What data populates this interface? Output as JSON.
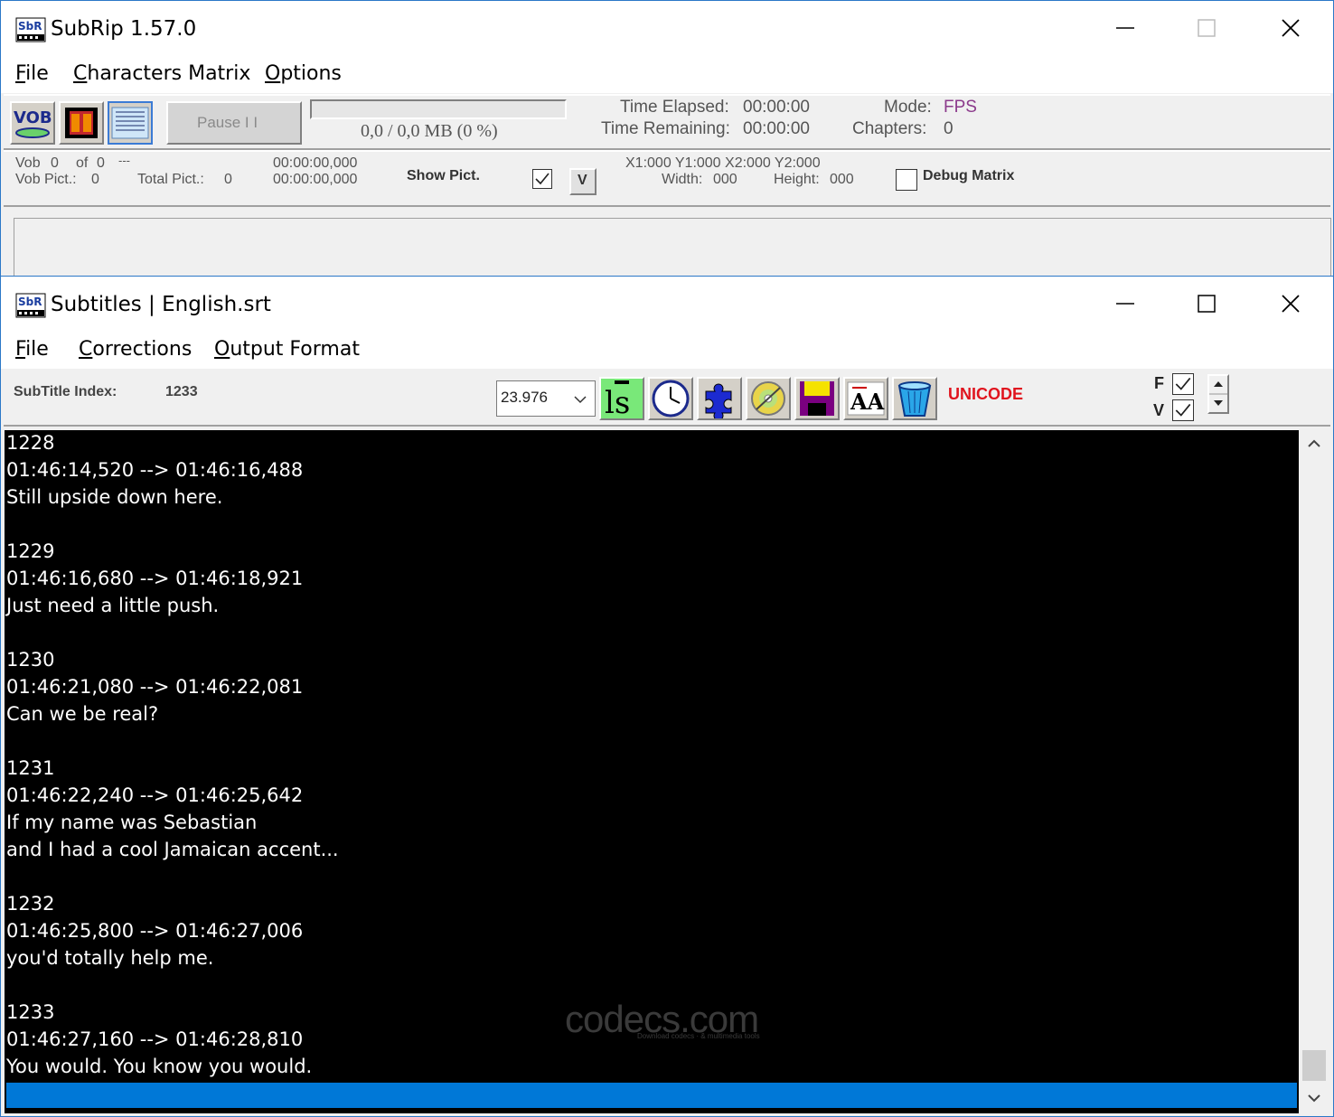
{
  "main_window": {
    "title": "SubRip 1.57.0",
    "menu": [
      {
        "mn": "F",
        "rest": "ile"
      },
      {
        "mn": "C",
        "rest": "haracters Matrix"
      },
      {
        "mn": "O",
        "rest": "ptions"
      }
    ],
    "toolbar": {
      "pause_label": "Pause  I I",
      "progress_text": "0,0 / 0,0 MB (0 %)",
      "progress_fraction": 0,
      "time_elapsed_label": "Time Elapsed:",
      "time_elapsed": "00:00:00",
      "time_remaining_label": "Time Remaining:",
      "time_remaining": "00:00:00",
      "mode_label": "Mode:",
      "mode_value": "FPS",
      "chapters_label": "Chapters:",
      "chapters_value": "0"
    },
    "info": {
      "vob_label": "Vob",
      "vob_value": "0",
      "of_label": "of",
      "of_value": "0",
      "dashes": "---",
      "vob_pict_label": "Vob Pict.:",
      "vob_pict_value": "0",
      "total_pict_label": "Total Pict.:",
      "total_pict_value": "0",
      "time1": "00:00:00,000",
      "time2": "00:00:00,000",
      "show_pict": "Show Pict.",
      "v_button": "V",
      "coords": "X1:000  Y1:000  X2:000  Y2:000",
      "width_label": "Width:",
      "width_value": "000",
      "height_label": "Height:",
      "height_value": "000",
      "debug_matrix": "Debug Matrix"
    }
  },
  "subtitles_window": {
    "title": "Subtitles | English.srt",
    "menu": [
      {
        "mn": "F",
        "rest": "ile"
      },
      {
        "mn": "C",
        "rest": "orrections"
      },
      {
        "mn": "O",
        "rest": "utput Format"
      }
    ],
    "toolbar": {
      "index_label": "SubTitle Index:",
      "index_value": "1233",
      "fps_value": "23.976",
      "unicode_label": "UNICODE",
      "f_label": "F",
      "v_label": "V"
    },
    "lines": [
      "1228",
      "01:46:14,520 --> 01:46:16,488",
      "Still upside down here.",
      "",
      "1229",
      "01:46:16,680 --> 01:46:18,921",
      "Just need a little push.",
      "",
      "1230",
      "01:46:21,080 --> 01:46:22,081",
      "Can we be real?",
      "",
      "1231",
      "01:46:22,240 --> 01:46:25,642",
      "If my name was Sebastian",
      "and I had a cool Jamaican accent...",
      "",
      "1232",
      "01:46:25,800 --> 01:46:27,006",
      "you'd totally help me.",
      "",
      "1233",
      "01:46:27,160 --> 01:46:28,810",
      "You would. You know you would."
    ],
    "watermark": "codecs.com",
    "watermark_sub": "Download codecs · & multimedia tools"
  },
  "colors": {
    "accent": "#0078d7",
    "mode_value": "#8b3a8b",
    "unicode": "#e0141e"
  },
  "icons": [
    "app-icon",
    "minimize-icon",
    "maximize-icon",
    "close-icon",
    "vob-icon",
    "film-icon",
    "matrix-icon",
    "ls-icon",
    "clock-icon",
    "puzzle-icon",
    "disc-icon",
    "floppy-icon",
    "font-aa-icon",
    "trash-bucket-icon",
    "chevron-down-icon",
    "scroll-up-icon",
    "scroll-down-icon"
  ]
}
